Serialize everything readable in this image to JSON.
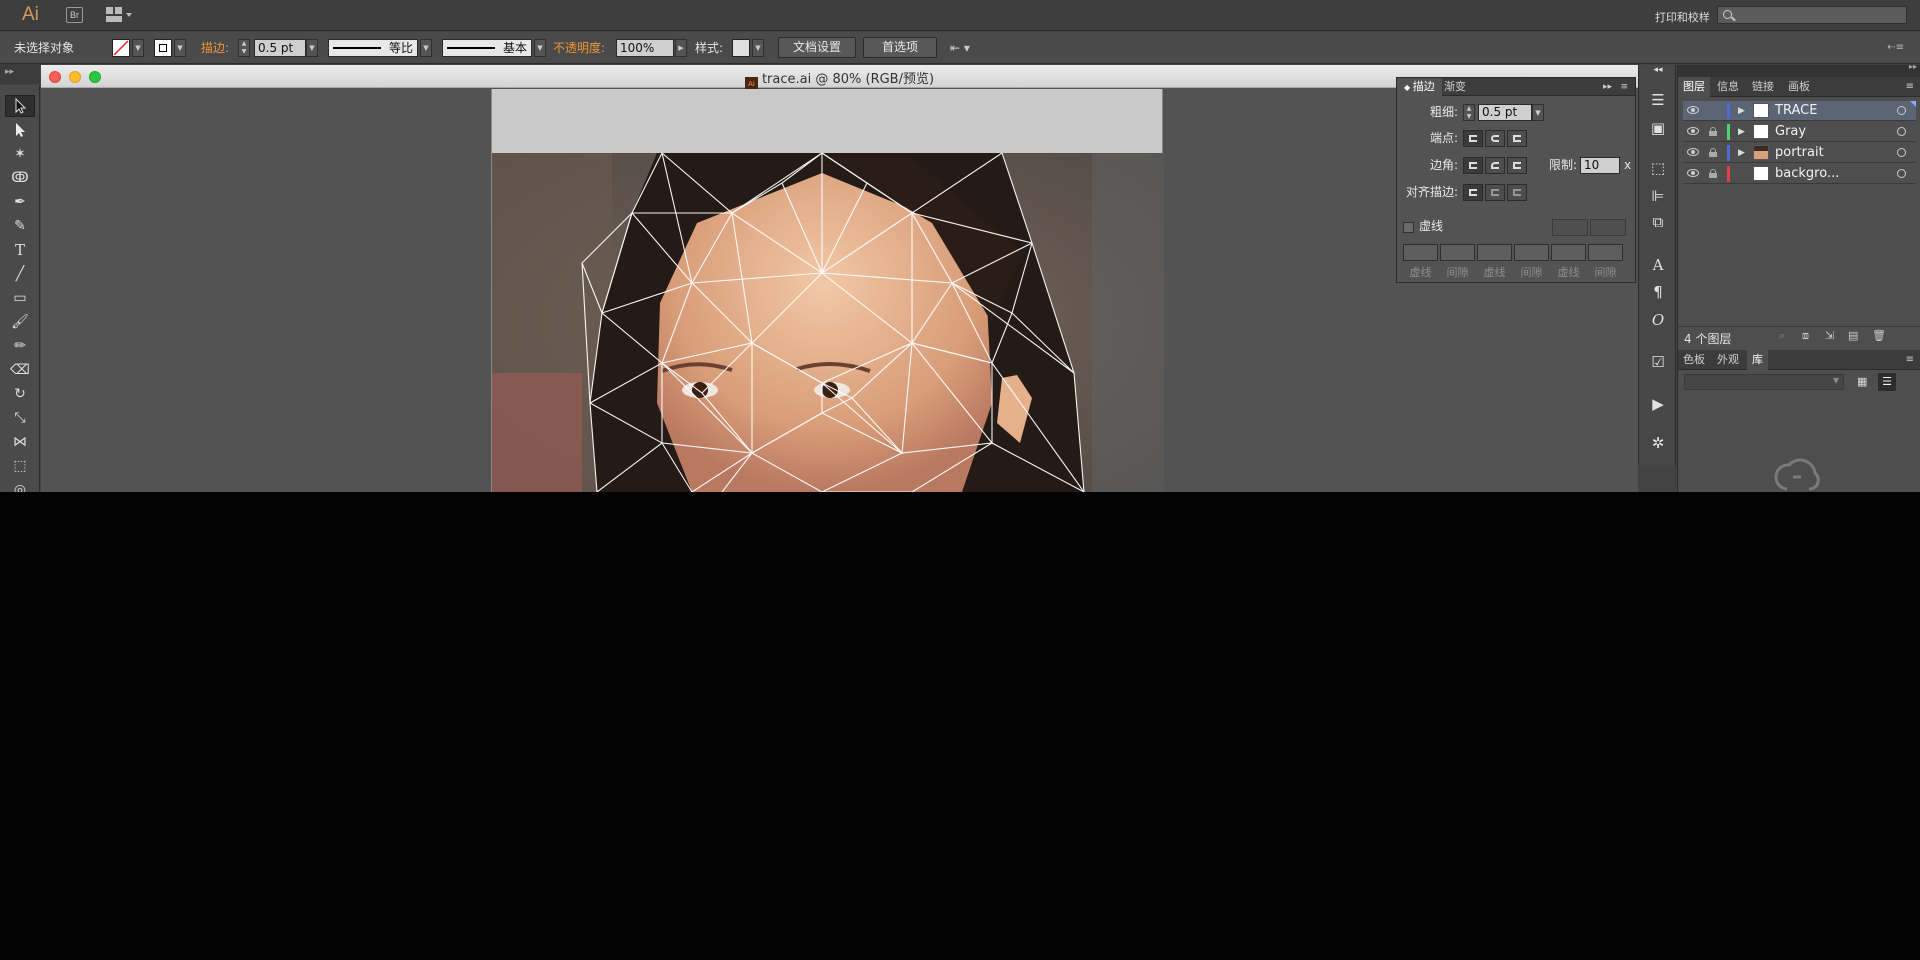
{
  "menubar": {
    "app_logo": "Ai",
    "bridge_label": "Br",
    "workspace": "打印和校样",
    "search_placeholder": ""
  },
  "control_bar": {
    "selection_status": "未选择对象",
    "stroke_label": "描边:",
    "stroke_weight": "0.5 pt",
    "variable_width_profile": "等比",
    "brush_definition": "基本",
    "opacity_label": "不透明度:",
    "opacity_value": "100%",
    "style_label": "样式:",
    "document_setup_button": "文档设置",
    "preferences_button": "首选项"
  },
  "document": {
    "title": "trace.ai @ 80% (RGB/预览)",
    "file_icon_label": "Ai",
    "zoom": "80%"
  },
  "stroke_panel": {
    "tabs": [
      "描边",
      "渐变"
    ],
    "weight_label": "粗细:",
    "weight_value": "0.5 pt",
    "cap_label": "端点:",
    "corner_label": "边角:",
    "limit_label": "限制:",
    "limit_value": "10",
    "limit_unit": "x",
    "align_label": "对齐描边:",
    "dashed_label": "虚线",
    "dash_labels": [
      "虚线",
      "间隙",
      "虚线",
      "间隙",
      "虚线",
      "间隙"
    ]
  },
  "layers_panel": {
    "tabs": [
      "图层",
      "信息",
      "链接",
      "画板"
    ],
    "layers": [
      {
        "name": "TRACE",
        "color": "#4f6bd8",
        "selected": true
      },
      {
        "name": "Gray",
        "color": "#4fd36b",
        "selected": false
      },
      {
        "name": "portrait",
        "color": "#4f6bd8",
        "selected": false
      },
      {
        "name": "backgro...",
        "color": "#e0404a",
        "selected": false
      }
    ],
    "count_text": "4 个图层"
  },
  "bottom_panel": {
    "tabs": [
      "色板",
      "外观",
      "库"
    ]
  },
  "colors": {
    "accent_orange": "#f09536",
    "selection_blue": "#5b6575"
  }
}
